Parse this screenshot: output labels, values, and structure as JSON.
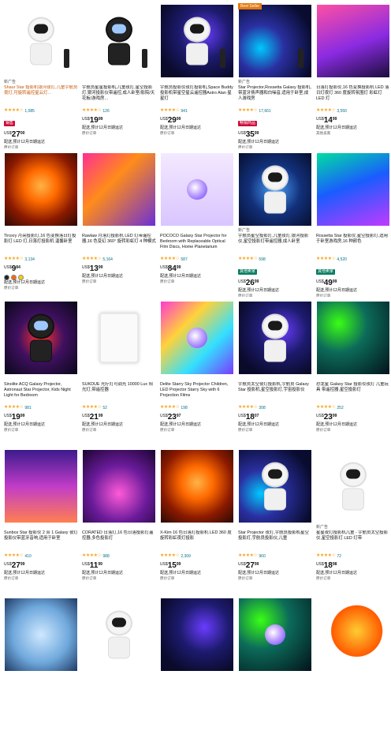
{
  "products": [
    {
      "tag": "新广告",
      "title": "Shaur Star 投影机银河夜灯,儿童宇航员夜灯,可旋转遥控星云灯...",
      "link": true,
      "stars": "★★★★☆",
      "count": "1,085",
      "badge": "销售",
      "cur": "US$",
      "price": "27",
      "cents": "00",
      "was": "",
      "ship": "配送,预计12月日期运达",
      "note": "原价订单",
      "img": "bg-white",
      "fig": "astro"
    },
    {
      "tag": "",
      "title": "宇航员星星投影机,儿童夜灯,星空投影灯,银河投影仪带遥控,成人卧室/影院/天花板/游戏房...",
      "link": false,
      "stars": "★★★★☆",
      "count": "126",
      "badge": "",
      "cur": "US$",
      "price": "19",
      "cents": "99",
      "was": "",
      "ship": "配送,预计12月日期运达",
      "note": "原价订单",
      "img": "bg-white",
      "fig": "astro-dark"
    },
    {
      "tag": "",
      "title": "宇航员投影仪夜灯投影机,Space Buddy 投影机带星空星云遥控器Astro Alan 星星灯",
      "link": false,
      "stars": "★★★★☆",
      "count": "941",
      "badge": "",
      "cur": "US$",
      "price": "29",
      "cents": "99",
      "was": "",
      "ship": "配送,预计12月日期运达",
      "note": "原价订单",
      "img": "bg-galaxy1",
      "fig": "astro"
    },
    {
      "tag": "新广告",
      "title": "Star Projector,Rossetta Galaxy 投影机,带蓝牙扬声器和白噪音,适用于卧室,成人游戏房",
      "link": false,
      "stars": "★★★★☆",
      "count": "17,661",
      "badge": "畅销商品",
      "cur": "US$",
      "price": "35",
      "cents": "99",
      "was": "",
      "ship": "配送,预计12月日期运达",
      "note": "原价订单",
      "img": "bg-galaxy2",
      "fig": "none"
    },
    {
      "tag": "",
      "title": "日落灯投影仪,16 色变换投影机 LED 落日灯夜灯 360 度旋转氛围灯 彩虹灯 LED 灯",
      "link": false,
      "stars": "★★★★☆",
      "count": "3,550",
      "badge": "",
      "cur": "US$",
      "price": "14",
      "cents": "99",
      "was": "",
      "ship": "配送,预计12月日期运达",
      "note": "其他卖家",
      "img": "bg-pink",
      "fig": "none"
    },
    {
      "tag": "",
      "title": "Tiroxry 月亮投影灯,16 色变换落日灯投影灯 LED 灯,日落灯投影机 温馨卧室",
      "link": false,
      "stars": "★★★★☆",
      "count": "3,134",
      "badge": "",
      "cur": "US$",
      "price": "9",
      "cents": "84",
      "was": "",
      "ship": "配送,预计12月日期运达",
      "note": "原价订单",
      "img": "bg-sunset",
      "fig": "none",
      "dots": true
    },
    {
      "tag": "",
      "title": "Rawlaw 月落灯投影机 LED 灯带遥控器,16 色变幻 360° 旋转彩虹灯 4 种模式",
      "link": false,
      "stars": "★★★★☆",
      "count": "5,164",
      "badge": "",
      "cur": "US$",
      "price": "13",
      "cents": "99",
      "was": "",
      "ship": "配送,预计12月日期运达",
      "note": "原价订单",
      "img": "bg-plant",
      "fig": "none"
    },
    {
      "tag": "",
      "title": "POCOCO Galaxy Star Projector for Bedroom with Replaceable Optical Film Discs, Home Planetarium",
      "link": false,
      "stars": "★★★★☆",
      "count": "587",
      "badge": "",
      "cur": "US$",
      "price": "84",
      "cents": "99",
      "was": "",
      "ship": "配送,预计12月日期运达",
      "note": "原价订单",
      "img": "bg-lamp",
      "fig": "orb"
    },
    {
      "tag": "新广告",
      "title": "宇航员星空投影灯,儿童夜灯,银河投影仪,星空投影灯带遥控器,成人卧室",
      "link": false,
      "stars": "★★★★☆",
      "count": "598",
      "badge": "其他卖家",
      "cur": "US$",
      "price": "26",
      "cents": "99",
      "was": "",
      "ship": "配送,预计12月日期运达",
      "note": "原价订单",
      "img": "bg-blue",
      "fig": "astro"
    },
    {
      "tag": "",
      "title": "Rossetta Star 投影仪,星空投影灯,适用于卧室游戏房,16 种颜色",
      "link": false,
      "stars": "★★★★☆",
      "count": "4,520",
      "badge": "其他卖家",
      "cur": "US$",
      "price": "49",
      "cents": "99",
      "was": "",
      "ship": "配送,预计12月日期运达",
      "note": "原价订单",
      "img": "bg-aurora",
      "fig": "none"
    },
    {
      "tag": "",
      "title": "Sinolite ACQ Galaxy Projector, Astronaut Star Projector, Kids Night Light for Bedroom",
      "link": false,
      "stars": "★★★★☆",
      "count": "981",
      "badge": "",
      "cur": "US$",
      "price": "19",
      "cents": "99",
      "was": "",
      "ship": "配送,预计12月日期运达",
      "note": "原价订单",
      "img": "bg-dark",
      "fig": "astro-dark"
    },
    {
      "tag": "",
      "title": "SUKDUE 光疗灯可调光 10000 Lux 阳光灯,带遥控器",
      "link": false,
      "stars": "★★★★☆",
      "count": "52",
      "badge": "",
      "cur": "US$",
      "price": "21",
      "cents": "99",
      "was": "",
      "ship": "配送,预计12月日期运达",
      "note": "原价订单",
      "img": "bg-white",
      "fig": "panel"
    },
    {
      "tag": "",
      "title": "Delite Starry Sky Projector Children, LED Projector Starry Sky with 6 Projection Films",
      "link": false,
      "stars": "★★★★☆",
      "count": "198",
      "badge": "",
      "cur": "US$",
      "price": "23",
      "cents": "97",
      "was": "",
      "ship": "配送,预计12月日期运达",
      "note": "原价订单",
      "img": "bg-multi",
      "fig": "orb"
    },
    {
      "tag": "",
      "title": "宇航员太空夜灯投影机,宇航员 Galaxy Star 投影机,星空投影灯,宇宙投影仪",
      "link": false,
      "stars": "★★★★☆",
      "count": "308",
      "badge": "",
      "cur": "US$",
      "price": "18",
      "cents": "07",
      "was": "",
      "ship": "配送,预计12月日期运达",
      "note": "原价订单",
      "img": "bg-galaxy1",
      "fig": "astro"
    },
    {
      "tag": "",
      "title": "恐龙星 Galaxy Star 投影仪夜灯 儿童玩具 带遥控器,星空投影灯",
      "link": false,
      "stars": "★★★★☆",
      "count": "252",
      "badge": "",
      "cur": "US$",
      "price": "23",
      "cents": "99",
      "was": "",
      "ship": "配送,预计12月日期运达",
      "note": "原价订单",
      "img": "bg-neon",
      "fig": "none"
    },
    {
      "tag": "",
      "title": "Sunbox Star 投影仪 2 合 1 Galaxy 夜灯投影仪带蓝牙音响,适用于卧室",
      "link": false,
      "stars": "★★★★☆",
      "count": "410",
      "badge": "",
      "cur": "US$",
      "price": "27",
      "cents": "99",
      "was": "",
      "ship": "配送,预计12月日期运达",
      "note": "原价订单",
      "img": "bg-room",
      "fig": "none"
    },
    {
      "tag": "",
      "title": "CORATED 日落灯,16 色日落投影灯遥控器,多色投影灯",
      "link": false,
      "stars": "★★★★☆",
      "count": "988",
      "badge": "",
      "cur": "US$",
      "price": "11",
      "cents": "99",
      "was": "",
      "ship": "配送,预计12月日期运达",
      "note": "原价订单",
      "img": "bg-purple",
      "fig": "none"
    },
    {
      "tag": "",
      "title": "X-Kim 16 色日落灯投影机 LED 360 度旋转彩虹夜灯投影",
      "link": false,
      "stars": "★★★★☆",
      "count": "2,309",
      "badge": "",
      "cur": "US$",
      "price": "15",
      "cents": "99",
      "was": "",
      "ship": "配送,预计12月日期运达",
      "note": "原价订单",
      "img": "bg-sunset",
      "fig": "none"
    },
    {
      "tag": "",
      "title": "Star Projector 夜灯,宇航员投影机星空投影灯,宇航员投影仪,儿童",
      "link": false,
      "stars": "★★★★☆",
      "count": "960",
      "badge": "",
      "cur": "US$",
      "price": "27",
      "cents": "99",
      "was": "",
      "ship": "配送,预计12月日期运达",
      "note": "原价订单",
      "img": "bg-galaxy2",
      "fig": "astro"
    },
    {
      "tag": "新广告",
      "title": "星星夜灯投影机儿童 - 宇航员太空投影仪,星空投影灯 LED 灯带",
      "link": false,
      "stars": "★★★★☆",
      "count": "72",
      "badge": "",
      "cur": "US$",
      "price": "18",
      "cents": "98",
      "was": "",
      "ship": "配送,预计12月日期运达",
      "note": "原价订单",
      "img": "bg-white",
      "fig": "astro"
    },
    {
      "tag": "",
      "title": "",
      "link": false,
      "stars": "",
      "count": "",
      "badge": "",
      "cur": "",
      "price": "",
      "cents": "",
      "was": "",
      "ship": "",
      "note": "",
      "img": "bg-snow",
      "fig": "none"
    },
    {
      "tag": "",
      "title": "",
      "link": false,
      "stars": "",
      "count": "",
      "badge": "",
      "cur": "",
      "price": "",
      "cents": "",
      "was": "",
      "ship": "",
      "note": "",
      "img": "bg-white",
      "fig": "astro"
    },
    {
      "tag": "",
      "title": "",
      "link": false,
      "stars": "",
      "count": "",
      "badge": "",
      "cur": "",
      "price": "",
      "cents": "",
      "was": "",
      "ship": "",
      "note": "",
      "img": "bg-galaxy1",
      "fig": "none"
    },
    {
      "tag": "",
      "title": "",
      "link": false,
      "stars": "",
      "count": "",
      "badge": "",
      "cur": "",
      "price": "",
      "cents": "",
      "was": "",
      "ship": "",
      "note": "",
      "img": "bg-neon",
      "fig": "orb"
    },
    {
      "tag": "",
      "title": "",
      "link": false,
      "stars": "",
      "count": "",
      "badge": "",
      "cur": "",
      "price": "",
      "cents": "",
      "was": "",
      "ship": "",
      "note": "",
      "img": "bg-orange",
      "fig": "none"
    }
  ],
  "flag": "Best Seller"
}
